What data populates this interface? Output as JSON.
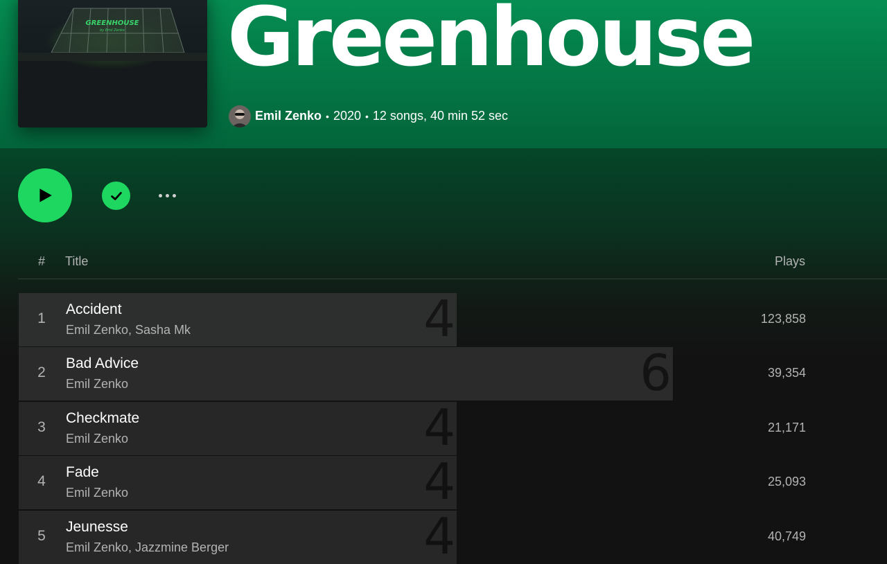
{
  "album": {
    "title": "Greenhouse",
    "cover_title": "GREENHOUSE",
    "cover_subtitle": "by Emil Zenko",
    "artist": "Emil Zenko",
    "year": "2020",
    "summary": "12 songs, 40 min 52 sec",
    "separator": "•"
  },
  "colors": {
    "header_green": "#058e53",
    "accent_green": "#1ed760",
    "background": "#121212"
  },
  "actions": {
    "play_icon": "play-icon",
    "saved_icon": "check-icon",
    "more_icon": "more-horizontal-icon"
  },
  "columns": {
    "number": "#",
    "title": "Title",
    "plays": "Plays"
  },
  "tracks": [
    {
      "number": "1",
      "title": "Accident",
      "artists": "Emil Zenko, Sasha Mk",
      "plays": "123,858",
      "bar_label": "4",
      "bar_fraction": 0.67
    },
    {
      "number": "2",
      "title": "Bad Advice",
      "artists": "Emil Zenko",
      "plays": "39,354",
      "bar_label": "6",
      "bar_fraction": 1.0
    },
    {
      "number": "3",
      "title": "Checkmate",
      "artists": "Emil Zenko",
      "plays": "21,171",
      "bar_label": "4",
      "bar_fraction": 0.67
    },
    {
      "number": "4",
      "title": "Fade",
      "artists": "Emil Zenko",
      "plays": "25,093",
      "bar_label": "4",
      "bar_fraction": 0.67
    },
    {
      "number": "5",
      "title": "Jeunesse",
      "artists": "Emil Zenko, Jazzmine Berger",
      "plays": "40,749",
      "bar_label": "4",
      "bar_fraction": 0.67
    }
  ]
}
